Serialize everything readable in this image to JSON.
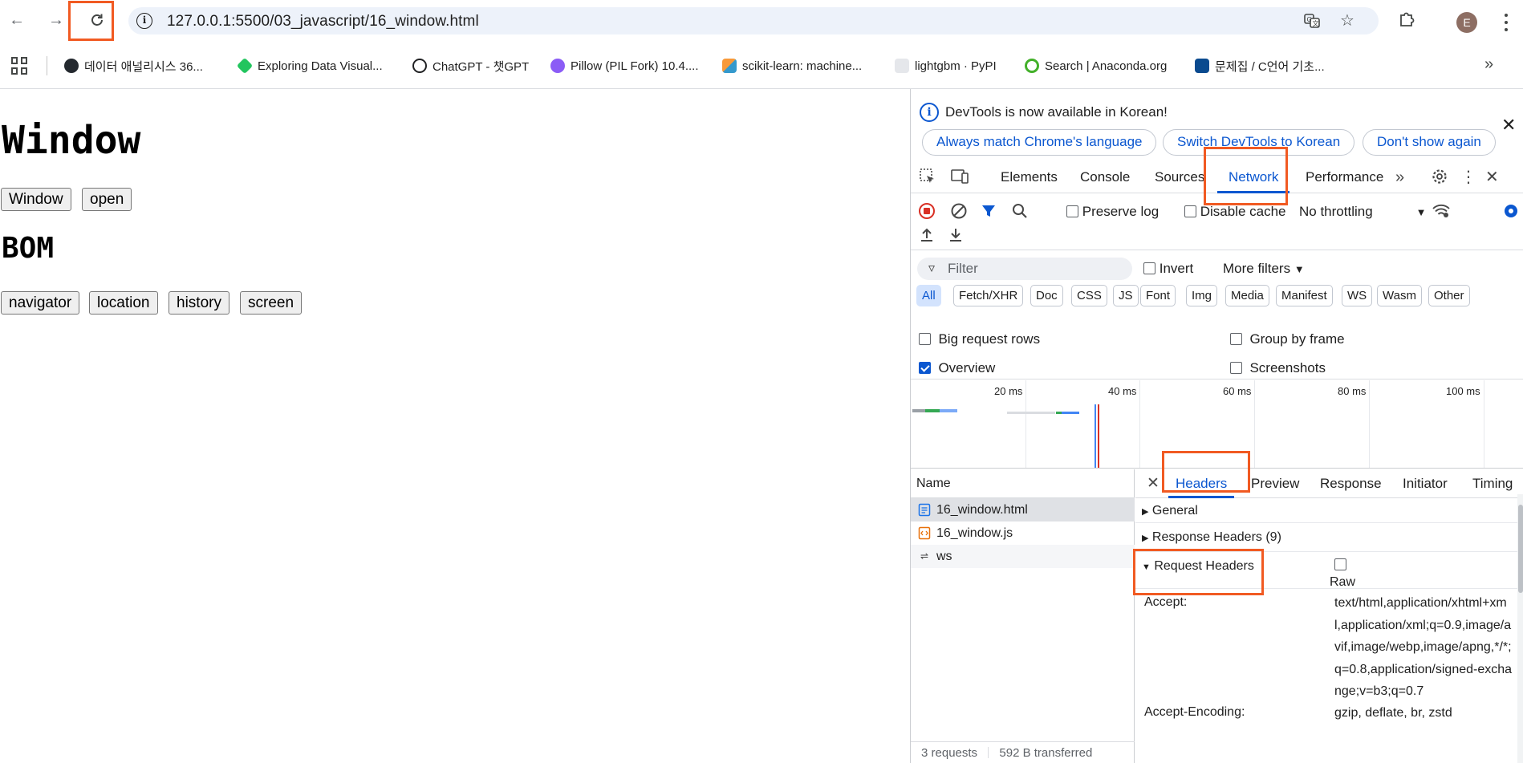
{
  "browser": {
    "url": "127.0.0.1:5500/03_javascript/16_window.html",
    "bookmarks": [
      {
        "label": "데이터 애널리시스 36...",
        "color": "#24292f"
      },
      {
        "label": "Exploring Data Visual...",
        "color": "#22c55e"
      },
      {
        "label": "ChatGPT - 챗GPT",
        "color": "#202123"
      },
      {
        "label": "Pillow (PIL Fork) 10.4....",
        "color": "#8b5cf6"
      },
      {
        "label": "scikit-learn: machine...",
        "color": "#f89939"
      },
      {
        "label": "lightgbm · PyPI",
        "color": "#d1d5db"
      },
      {
        "label": "Search | Anaconda.org",
        "color": "#43b02a"
      },
      {
        "label": "문제집 / C언어 기초...",
        "color": "#0a4a8f"
      }
    ]
  },
  "page": {
    "heading_window": "Window",
    "buttons_window": [
      "Window",
      "open"
    ],
    "heading_bom": "BOM",
    "buttons_bom": [
      "navigator",
      "location",
      "history",
      "screen"
    ]
  },
  "devtools": {
    "infobar": {
      "message": "DevTools is now available in Korean!",
      "btn_match": "Always match Chrome's language",
      "btn_switch": "Switch DevTools to Korean",
      "btn_dont_show": "Don't show again"
    },
    "tabs": [
      "Elements",
      "Console",
      "Sources",
      "Network",
      "Performance"
    ],
    "active_tab": "Network",
    "toolbar": {
      "preserve_log": "Preserve log",
      "disable_cache": "Disable cache",
      "throttling": "No throttling"
    },
    "filter": {
      "placeholder": "Filter",
      "invert": "Invert",
      "more_filters": "More filters",
      "types": [
        "All",
        "Fetch/XHR",
        "Doc",
        "CSS",
        "JS",
        "Font",
        "Img",
        "Media",
        "Manifest",
        "WS",
        "Wasm",
        "Other"
      ],
      "active_type": "All"
    },
    "options": {
      "big_request_rows": "Big request rows",
      "group_by_frame": "Group by frame",
      "overview": "Overview",
      "screenshots": "Screenshots",
      "overview_checked": true
    },
    "timeline_ticks": [
      "20 ms",
      "40 ms",
      "60 ms",
      "80 ms",
      "100 ms"
    ],
    "requests": {
      "column": "Name",
      "items": [
        {
          "name": "16_window.html",
          "type": "document"
        },
        {
          "name": "16_window.js",
          "type": "script"
        },
        {
          "name": "ws",
          "type": "websocket"
        }
      ],
      "status": {
        "count": "3 requests",
        "transferred": "592 B transferred"
      }
    },
    "detail": {
      "tabs": [
        "Headers",
        "Preview",
        "Response",
        "Initiator",
        "Timing"
      ],
      "active_tab": "Headers",
      "sections": {
        "general": "General",
        "response_headers": "Response Headers (9)",
        "request_headers": "Request Headers",
        "raw": "Raw"
      },
      "request_headers": [
        {
          "key": "Accept:",
          "value": "text/html,application/xhtml+xml,application/xml;q=0.9,image/avif,image/webp,image/apng,*/*;q=0.8,application/signed-exchange;v=b3;q=0.7"
        },
        {
          "key": "Accept-Encoding:",
          "value": "gzip, deflate, br, zstd"
        }
      ]
    }
  },
  "colors": {
    "accent": "#0b57d0",
    "highlight": "#f15a22",
    "record_red": "#d93025"
  }
}
